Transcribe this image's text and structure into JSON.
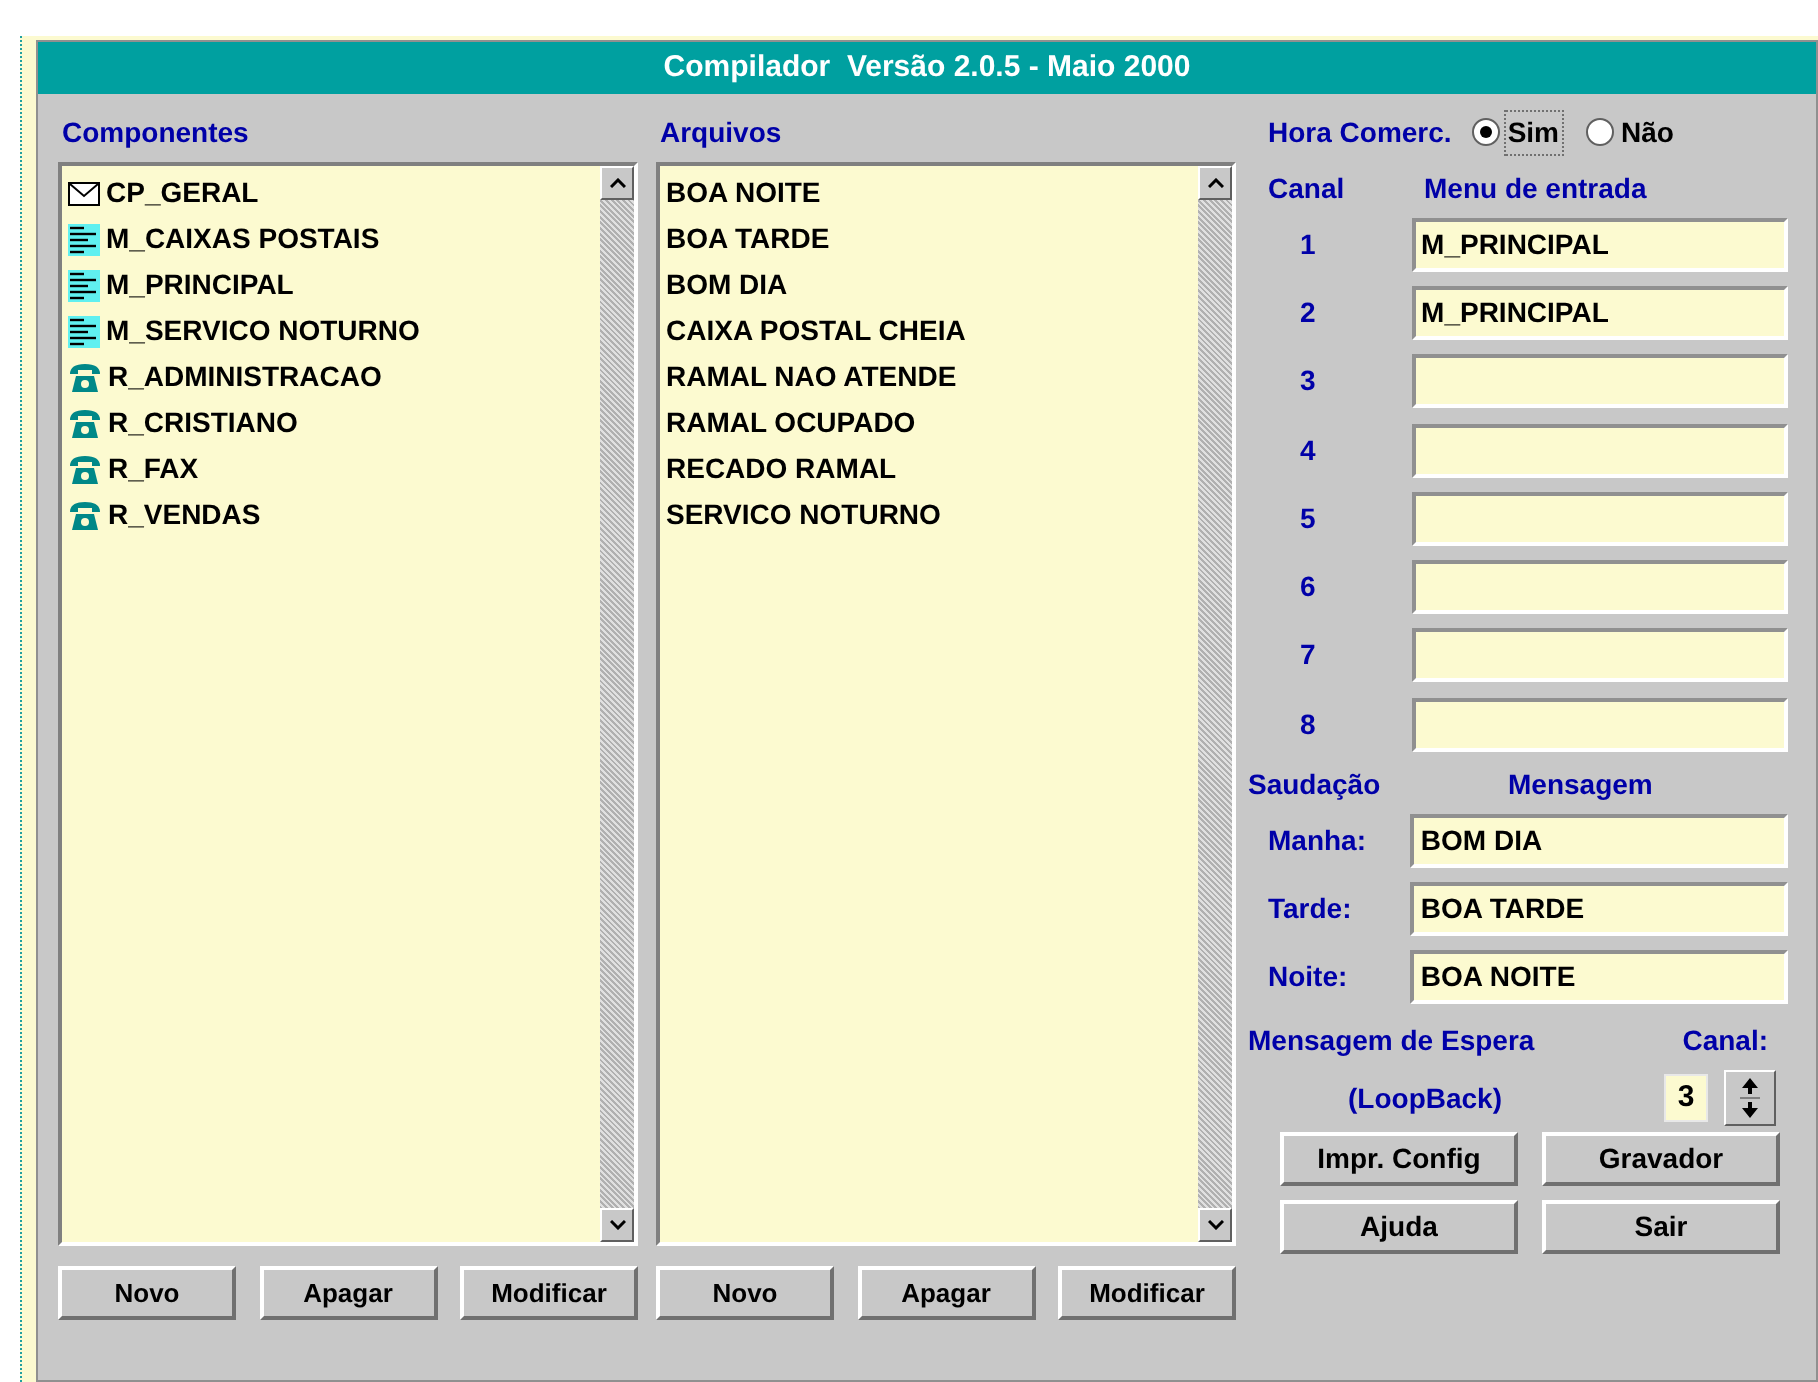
{
  "window": {
    "title": "Compilador  Versão 2.0.5 - Maio 2000"
  },
  "componentes": {
    "label": "Componentes",
    "items": [
      {
        "kind": "mailbox",
        "text": "CP_GERAL"
      },
      {
        "kind": "menu",
        "text": "M_CAIXAS POSTAIS"
      },
      {
        "kind": "menu",
        "text": "M_PRINCIPAL"
      },
      {
        "kind": "menu",
        "text": "M_SERVICO NOTURNO"
      },
      {
        "kind": "extension",
        "text": "R_ADMINISTRACAO"
      },
      {
        "kind": "extension",
        "text": "R_CRISTIANO"
      },
      {
        "kind": "extension",
        "text": "R_FAX"
      },
      {
        "kind": "extension",
        "text": "R_VENDAS"
      }
    ],
    "buttons": [
      "Novo",
      "Apagar",
      "Modificar"
    ]
  },
  "arquivos": {
    "label": "Arquivos",
    "items": [
      {
        "text": "BOA NOITE"
      },
      {
        "text": "BOA TARDE"
      },
      {
        "text": "BOM DIA"
      },
      {
        "text": "CAIXA POSTAL CHEIA"
      },
      {
        "text": "RAMAL NAO ATENDE"
      },
      {
        "text": "RAMAL OCUPADO"
      },
      {
        "text": "RECADO RAMAL"
      },
      {
        "text": "SERVICO NOTURNO"
      }
    ],
    "buttons": [
      "Novo",
      "Apagar",
      "Modificar"
    ]
  },
  "hora_comercial": {
    "label": "Hora Comerc.",
    "options": [
      {
        "label": "Sim",
        "selected": true
      },
      {
        "label": "Não",
        "selected": false
      }
    ]
  },
  "canais": {
    "column_labels": [
      "Canal",
      "Menu de entrada"
    ],
    "rows": [
      {
        "number": "1",
        "value": "M_PRINCIPAL"
      },
      {
        "number": "2",
        "value": "M_PRINCIPAL"
      },
      {
        "number": "3"
      },
      {
        "number": "4"
      },
      {
        "number": "5"
      },
      {
        "number": "6"
      },
      {
        "number": "7"
      },
      {
        "number": "8"
      }
    ]
  },
  "saudacao": {
    "column_labels": [
      "Saudação",
      "Mensagem"
    ],
    "rows": [
      {
        "label": "Manha:",
        "value": "BOM DIA"
      },
      {
        "label": "Tarde:",
        "value": "BOA TARDE"
      },
      {
        "label": "Noite:",
        "value": "BOA NOITE"
      }
    ]
  },
  "espera": {
    "label": "Mensagem de Espera",
    "sublabel": "(LoopBack)",
    "canal_label": "Canal:",
    "canal_value": "3"
  },
  "buttons": [
    "Impr. Config",
    "Gravador",
    "Ajuda",
    "Sair"
  ]
}
